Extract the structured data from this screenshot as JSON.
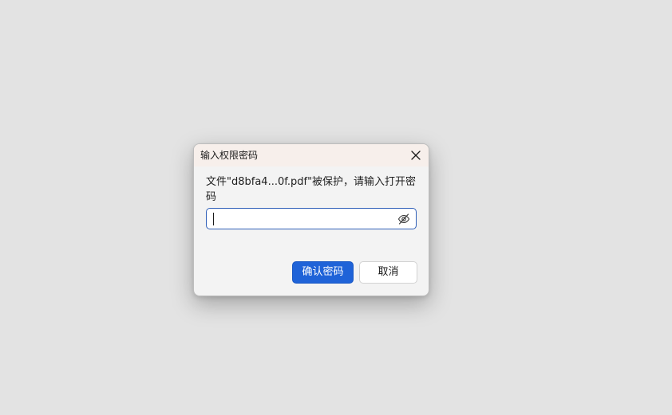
{
  "dialog": {
    "title": "输入权限密码",
    "message": "文件\"d8bfa4...0f.pdf\"被保护，请输入打开密码",
    "password": {
      "value": "",
      "placeholder": ""
    },
    "confirm_label": "确认密码",
    "cancel_label": "取消",
    "icons": {
      "close": "close-icon",
      "visibility": "eye-slash-icon"
    },
    "colors": {
      "primary": "#1f63d8",
      "focus_border": "#2f5fb8",
      "titlebar": "#f7efeb"
    }
  }
}
